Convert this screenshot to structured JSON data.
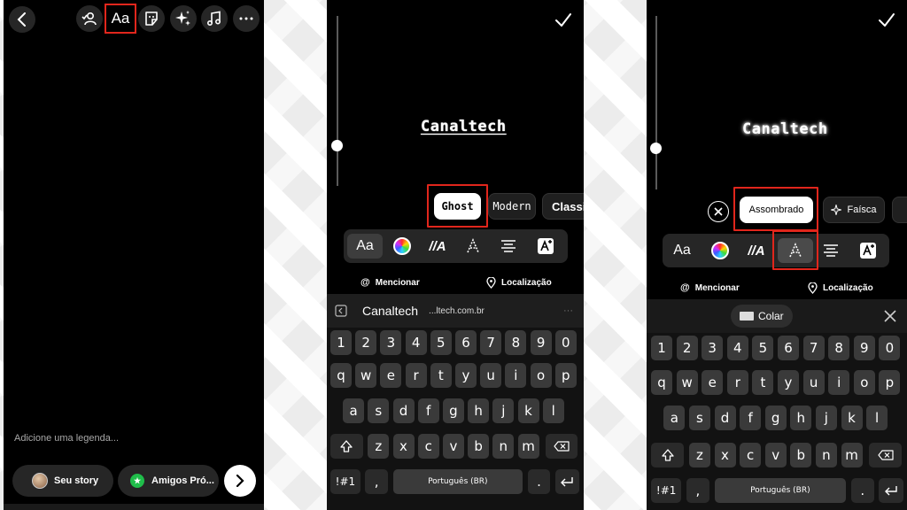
{
  "screen1": {
    "caption_placeholder": "Adicione uma legenda...",
    "your_story": "Seu story",
    "close_friends": "Amigos Pró...",
    "text_tool_label": "Aa"
  },
  "screen2": {
    "story_text": "Canaltech",
    "styles": [
      "Ghost",
      "Modern",
      "Classi"
    ],
    "mention": "Mencionar",
    "location": "Localização",
    "tool_text_label": "Aa",
    "tool_effect_label": "//A",
    "suggest_word": "Canaltech",
    "suggest_url": "...ltech.com.br",
    "suggest_more": "···"
  },
  "screen3": {
    "story_text": "Canaltech",
    "styles": [
      "Assombrado",
      "Faísca"
    ],
    "mention": "Mencionar",
    "location": "Localização",
    "tool_text_label": "Aa",
    "tool_effect_label": "//A",
    "paste_label": "Colar"
  },
  "keyboard": {
    "digits": [
      "1",
      "2",
      "3",
      "4",
      "5",
      "6",
      "7",
      "8",
      "9",
      "0"
    ],
    "row1": [
      "q",
      "w",
      "e",
      "r",
      "t",
      "y",
      "u",
      "i",
      "o",
      "p"
    ],
    "row2": [
      "a",
      "s",
      "d",
      "f",
      "g",
      "h",
      "j",
      "k",
      "l"
    ],
    "row3": [
      "z",
      "x",
      "c",
      "v",
      "b",
      "n",
      "m"
    ],
    "symbols": "!#1",
    "comma": ",",
    "space": "Português (BR)",
    "period": "."
  },
  "colors": {
    "highlight": "#e1261c",
    "accent_green": "#1fbd4a"
  }
}
